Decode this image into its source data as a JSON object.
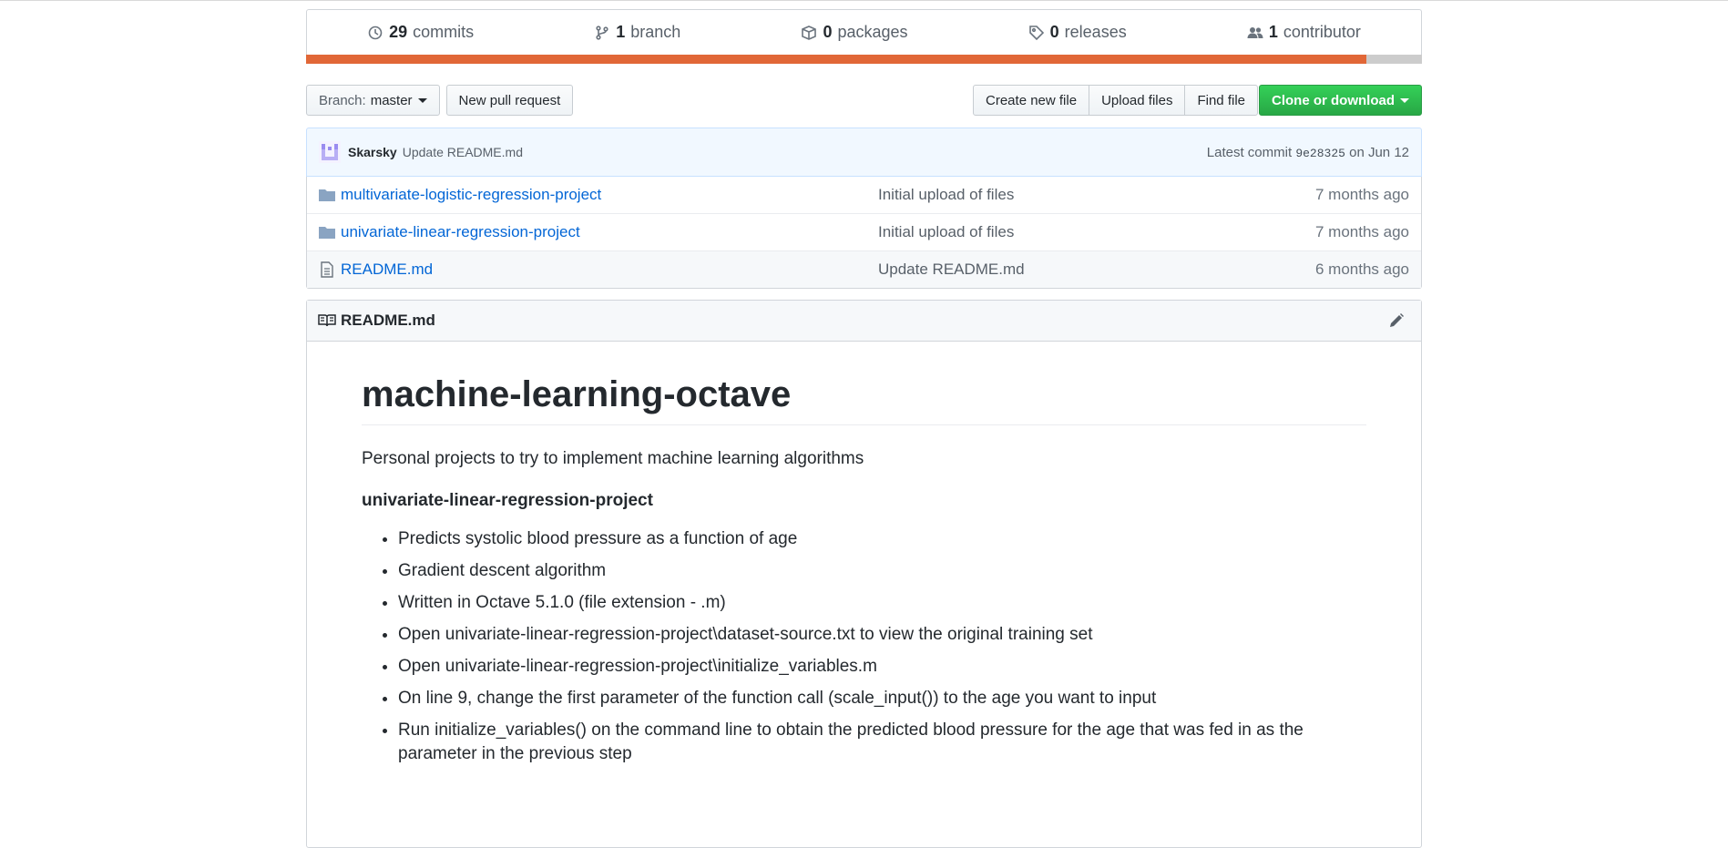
{
  "summary": {
    "commits": {
      "count": "29",
      "label": "commits"
    },
    "branches": {
      "count": "1",
      "label": "branch"
    },
    "packages": {
      "count": "0",
      "label": "packages"
    },
    "releases": {
      "count": "0",
      "label": "releases"
    },
    "contributors": {
      "count": "1",
      "label": "contributor"
    }
  },
  "language_bar": {
    "primary_color": "#e16737",
    "secondary_color": "#cccccc",
    "primary_fraction": 0.95
  },
  "file_nav": {
    "branch_prefix": "Branch:",
    "branch_name": "master",
    "new_pull_request": "New pull request",
    "create_new_file": "Create new file",
    "upload_files": "Upload files",
    "find_file": "Find file",
    "clone_or_download": "Clone or download"
  },
  "commit": {
    "author": "Skarsky",
    "message": "Update README.md",
    "latest_label": "Latest commit",
    "sha": "9e28325",
    "date": "on Jun 12"
  },
  "files": [
    {
      "type": "folder",
      "name": "multivariate-logistic-regression-project",
      "message": "Initial upload of files",
      "age": "7 months ago"
    },
    {
      "type": "folder",
      "name": "univariate-linear-regression-project",
      "message": "Initial upload of files",
      "age": "7 months ago"
    },
    {
      "type": "file",
      "name": "README.md",
      "message": "Update README.md",
      "age": "6 months ago"
    }
  ],
  "readme": {
    "filename": "README.md",
    "title": "machine-learning-octave",
    "intro": "Personal projects to try to implement machine learning algorithms",
    "section_heading": "univariate-linear-regression-project",
    "bullets": [
      "Predicts systolic blood pressure as a function of age",
      "Gradient descent algorithm",
      "Written in Octave 5.1.0 (file extension - .m)",
      "Open univariate-linear-regression-project\\dataset-source.txt to view the original training set",
      "Open univariate-linear-regression-project\\initialize_variables.m",
      "On line 9, change the first parameter of the function call (scale_input()) to the age you want to input",
      "Run initialize_variables() on the command line to obtain the predicted blood pressure for the age that was fed in as the parameter in the previous step"
    ]
  }
}
